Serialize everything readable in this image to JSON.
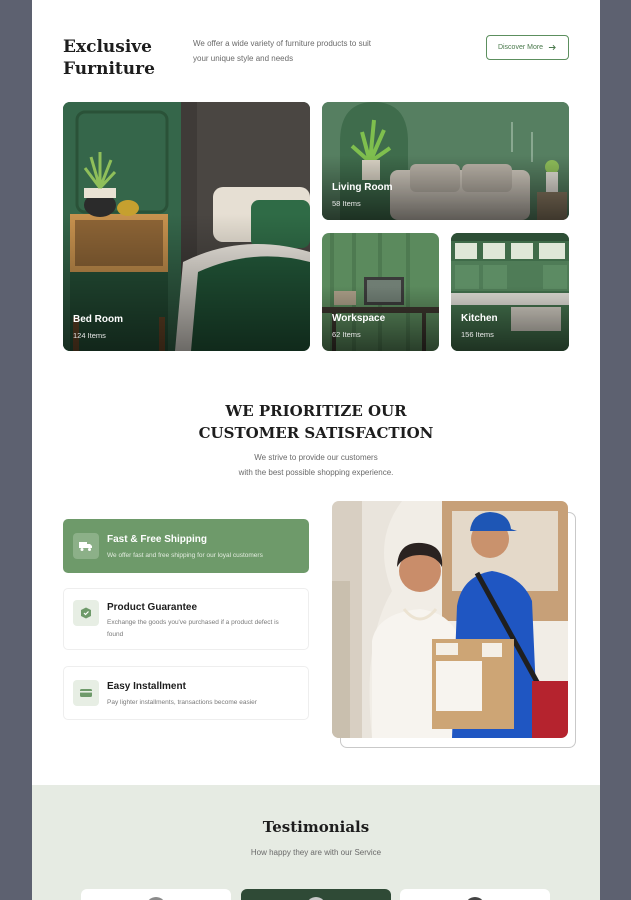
{
  "header": {
    "title_line1": "Exclusive",
    "title_line2": "Furniture",
    "desc_line1": "We offer a wide variety of furniture products to suit",
    "desc_line2": "your unique style and needs",
    "discover_label": "Discover More"
  },
  "categories": [
    {
      "name": "Bed Room",
      "count": "124 Items"
    },
    {
      "name": "Living Room",
      "count": "58 Items"
    },
    {
      "name": "Workspace",
      "count": "62 Items"
    },
    {
      "name": "Kitchen",
      "count": "156 Items"
    }
  ],
  "satisfaction": {
    "title_line1": "WE PRIORITIZE OUR",
    "title_line2": "CUSTOMER SATISFACTION",
    "sub_line1": "We strive to provide our customers",
    "sub_line2": "with the best possible shopping experience."
  },
  "features": [
    {
      "title": "Fast & Free Shipping",
      "desc": "We offer fast and free shipping for our loyal customers",
      "icon": "truck-icon",
      "active": true
    },
    {
      "title": "Product Guarantee",
      "desc": "Exchange the goods you've purchased if a product defect is found",
      "icon": "box-check-icon",
      "active": false
    },
    {
      "title": "Easy Installment",
      "desc": "Pay lighter installments, transactions become easier",
      "icon": "card-icon",
      "active": false
    }
  ],
  "testimonials": {
    "title": "Testimonials",
    "subtitle": "How happy they are with our Service"
  },
  "colors": {
    "accent": "#6e9a6a",
    "dark_green": "#2f4a36",
    "section_bg": "#e6ebe3"
  }
}
